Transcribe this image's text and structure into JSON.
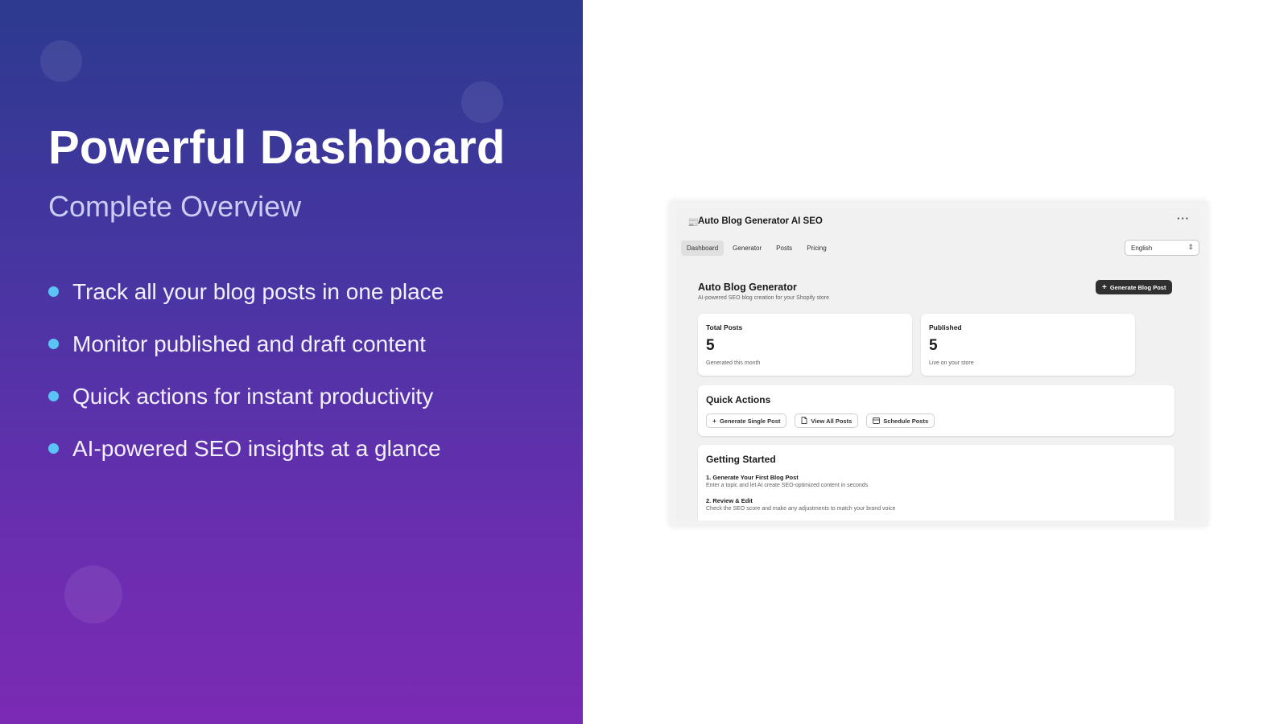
{
  "promo": {
    "headline": "Powerful Dashboard",
    "subheadline": "Complete Overview",
    "bullets": [
      "Track all your blog posts in one place",
      "Monitor published and draft content",
      "Quick actions for instant productivity",
      "AI-powered SEO insights at a glance"
    ],
    "bullet_color": "#5cc4f5"
  },
  "app": {
    "title": "Auto Blog Generator AI SEO",
    "logo_icon": "📰",
    "more_label": "···",
    "tabs": [
      {
        "label": "Dashboard",
        "active": true
      },
      {
        "label": "Generator",
        "active": false
      },
      {
        "label": "Posts",
        "active": false
      },
      {
        "label": "Pricing",
        "active": false
      }
    ],
    "language": {
      "selected": "English"
    },
    "page": {
      "title": "Auto Blog Generator",
      "subtitle": "AI-powered SEO blog creation for your Shopify store",
      "primary_action": "Generate Blog Post"
    },
    "stats": [
      {
        "label": "Total Posts",
        "value": "5",
        "caption": "Generated this month"
      },
      {
        "label": "Published",
        "value": "5",
        "caption": "Live on your store"
      }
    ],
    "quick_actions": {
      "title": "Quick Actions",
      "buttons": [
        {
          "label": "Generate Single Post",
          "icon": "plus-icon"
        },
        {
          "label": "View All Posts",
          "icon": "document-icon"
        },
        {
          "label": "Schedule Posts",
          "icon": "calendar-icon"
        }
      ]
    },
    "getting_started": {
      "title": "Getting Started",
      "steps": [
        {
          "title": "1. Generate Your First Blog Post",
          "desc": "Enter a topic and let AI create SEO-optimized content in seconds"
        },
        {
          "title": "2. Review & Edit",
          "desc": "Check the SEO score and make any adjustments to match your brand voice"
        }
      ]
    }
  }
}
